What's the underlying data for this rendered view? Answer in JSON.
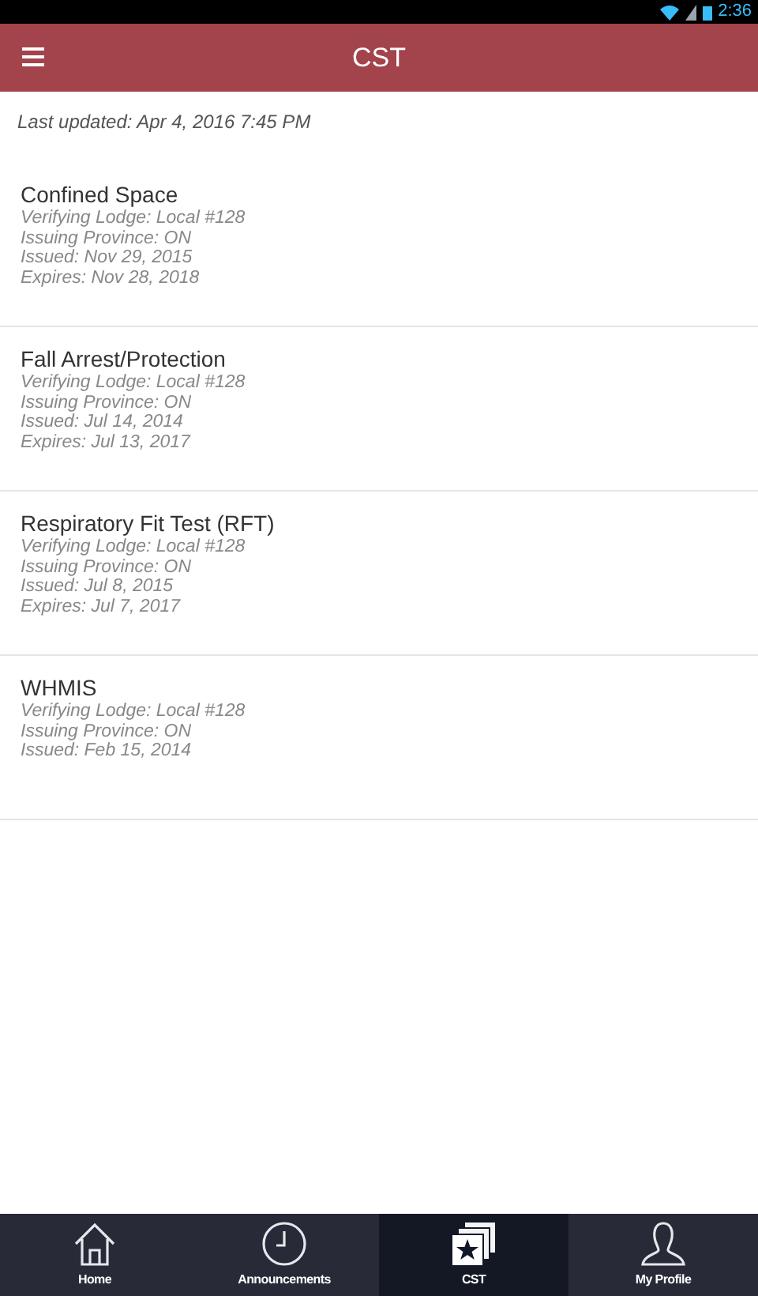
{
  "status_bar": {
    "time": "2:36"
  },
  "header": {
    "title": "CST"
  },
  "last_updated": "Last updated: Apr 4, 2016 7:45 PM",
  "certificates": [
    {
      "title": "Confined Space",
      "lines": [
        "Verifying Lodge: Local #128",
        "Issuing Province: ON",
        "Issued: Nov 29, 2015",
        "Expires: Nov 28, 2018"
      ]
    },
    {
      "title": "Fall Arrest/Protection",
      "lines": [
        "Verifying Lodge: Local #128",
        "Issuing Province: ON",
        "Issued: Jul 14, 2014",
        "Expires: Jul 13, 2017"
      ]
    },
    {
      "title": "Respiratory Fit Test (RFT)",
      "lines": [
        "Verifying Lodge: Local #128",
        "Issuing Province: ON",
        "Issued: Jul 8, 2015",
        "Expires: Jul 7, 2017"
      ]
    },
    {
      "title": "WHMIS",
      "lines": [
        "Verifying Lodge: Local #128",
        "Issuing Province: ON",
        "Issued: Feb 15, 2014"
      ]
    }
  ],
  "tabs": [
    {
      "label": "Home",
      "kind": "home",
      "selected": false
    },
    {
      "label": "Announcements",
      "kind": "clock",
      "selected": false
    },
    {
      "label": "CST",
      "kind": "cards",
      "selected": true
    },
    {
      "label": "My Profile",
      "kind": "person",
      "selected": false
    }
  ]
}
